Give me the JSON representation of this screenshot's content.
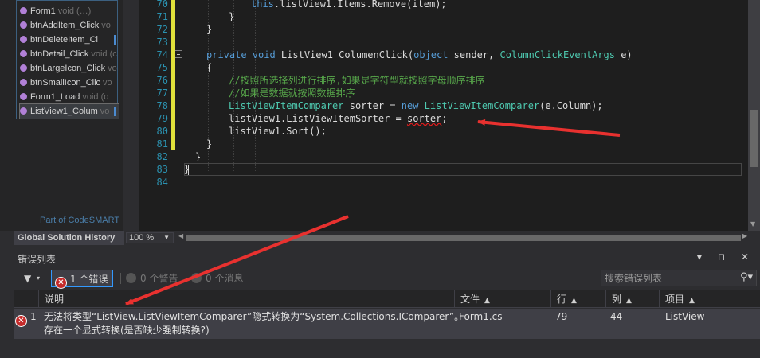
{
  "codemap": {
    "items": [
      {
        "name": "Form1",
        "suffix": "void (…)"
      },
      {
        "name": "btnAddItem_Click",
        "suffix": "vo"
      },
      {
        "name": "btnDeleteItem_Cl",
        "suffix": ""
      },
      {
        "name": "btnDetail_Click",
        "suffix": "void (c"
      },
      {
        "name": "btnLargeIcon_Click",
        "suffix": "vo"
      },
      {
        "name": "btnSmallIcon_Clic",
        "suffix": "vo"
      },
      {
        "name": "Form1_Load",
        "suffix": "void (o"
      },
      {
        "name": "ListView1_Colum",
        "suffix": "vo"
      }
    ],
    "brand": "Part of CodeSMART"
  },
  "editor": {
    "lines": [
      {
        "num": "70",
        "changed": true,
        "indent": 3,
        "parts": [
          {
            "t": "this",
            "c": "kw"
          },
          {
            "t": ".listView1.Items.Remove(item);",
            "c": "pl"
          }
        ]
      },
      {
        "num": "71",
        "changed": true,
        "indent": 2,
        "parts": [
          {
            "t": "}",
            "c": "pl"
          }
        ]
      },
      {
        "num": "72",
        "changed": true,
        "indent": 1,
        "parts": [
          {
            "t": "}",
            "c": "pl"
          }
        ]
      },
      {
        "num": "73",
        "changed": true,
        "indent": 0,
        "parts": []
      },
      {
        "num": "74",
        "changed": true,
        "indent": 1,
        "parts": [
          {
            "t": "private ",
            "c": "kw"
          },
          {
            "t": "void ",
            "c": "kw"
          },
          {
            "t": "ListView1_ColumenClick(",
            "c": "pl"
          },
          {
            "t": "object",
            "c": "kw"
          },
          {
            "t": " sender, ",
            "c": "pl"
          },
          {
            "t": "ColumnClickEventArgs",
            "c": "ty"
          },
          {
            "t": " e)",
            "c": "pl"
          }
        ]
      },
      {
        "num": "75",
        "changed": true,
        "indent": 1,
        "parts": [
          {
            "t": "{",
            "c": "pl"
          }
        ]
      },
      {
        "num": "76",
        "changed": true,
        "indent": 2,
        "parts": [
          {
            "t": "//按照所选择列进行排序,如果是字符型就按照字母顺序排序",
            "c": "cm"
          }
        ]
      },
      {
        "num": "77",
        "changed": true,
        "indent": 2,
        "parts": [
          {
            "t": "//如果是数据就按照数据排序",
            "c": "cm"
          }
        ]
      },
      {
        "num": "78",
        "changed": true,
        "indent": 2,
        "parts": [
          {
            "t": "ListViewItemComparer",
            "c": "ty"
          },
          {
            "t": " sorter = ",
            "c": "pl"
          },
          {
            "t": "new ",
            "c": "kw"
          },
          {
            "t": "ListViewItemComparer",
            "c": "ty"
          },
          {
            "t": "(e.Column);",
            "c": "pl"
          }
        ]
      },
      {
        "num": "79",
        "changed": true,
        "indent": 2,
        "parts": [
          {
            "t": "listView1.ListViewItemSorter = ",
            "c": "pl"
          },
          {
            "t": "sorter",
            "c": "pl squig"
          },
          {
            "t": ";",
            "c": "pl"
          }
        ]
      },
      {
        "num": "80",
        "changed": true,
        "indent": 2,
        "parts": [
          {
            "t": "listView1.Sort();",
            "c": "pl"
          }
        ]
      },
      {
        "num": "81",
        "changed": true,
        "indent": 1,
        "parts": [
          {
            "t": "}",
            "c": "pl"
          }
        ]
      },
      {
        "num": "82",
        "changed": false,
        "indent": 0.5,
        "parts": [
          {
            "t": "}",
            "c": "pl"
          }
        ]
      },
      {
        "num": "83",
        "changed": false,
        "indent": 0,
        "parts": [
          {
            "t": "}",
            "c": "pl"
          }
        ]
      },
      {
        "num": "84",
        "changed": false,
        "indent": 0,
        "parts": []
      }
    ]
  },
  "status": {
    "global_history": "Global Solution History",
    "zoom": "100 %"
  },
  "error_list": {
    "title": "错误列表",
    "window_buttons": "▾ ⊓ ✕",
    "errors_label": "1 个错误",
    "warnings_label": "0 个警告",
    "messages_label": "0 个消息",
    "search_placeholder": "搜索错误列表",
    "columns": {
      "description": "说明",
      "file": "文件",
      "line": "行",
      "column": "列",
      "project": "项目"
    },
    "rows": [
      {
        "index": "1",
        "description_line1": "无法将类型“ListView.ListViewItemComparer”隐式转换为“System.Collections.IComparer”。",
        "description_line2": "存在一个显式转换(是否缺少强制转换?)",
        "file": "Form1.cs",
        "line": "79",
        "column": "44",
        "project": "ListView"
      }
    ]
  },
  "colors": {
    "error_red": "#c52b2b",
    "annotation_red": "#e8312f",
    "keyword_blue": "#569cd6",
    "type_teal": "#4ec9b0",
    "comment_green": "#57a64a"
  }
}
